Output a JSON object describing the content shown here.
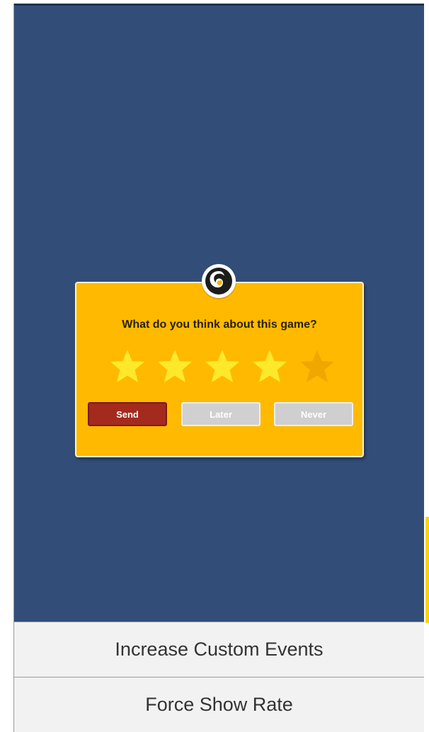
{
  "dialog": {
    "question": "What do you think about this game?",
    "rating": 4,
    "max_rating": 5,
    "send_label": "Send",
    "later_label": "Later",
    "never_label": "Never"
  },
  "menu": {
    "increase_events_label": "Increase Custom Events",
    "force_show_rate_label": "Force Show Rate"
  },
  "colors": {
    "background": "#324e78",
    "dialog": "#ffba00",
    "star_filled": "#fde92a",
    "star_empty": "#f0a800",
    "send_button": "#a32a1d",
    "secondary_button": "#d0d0d0"
  },
  "icons": {
    "logo": "swirl-logo-icon",
    "star": "star-icon"
  }
}
